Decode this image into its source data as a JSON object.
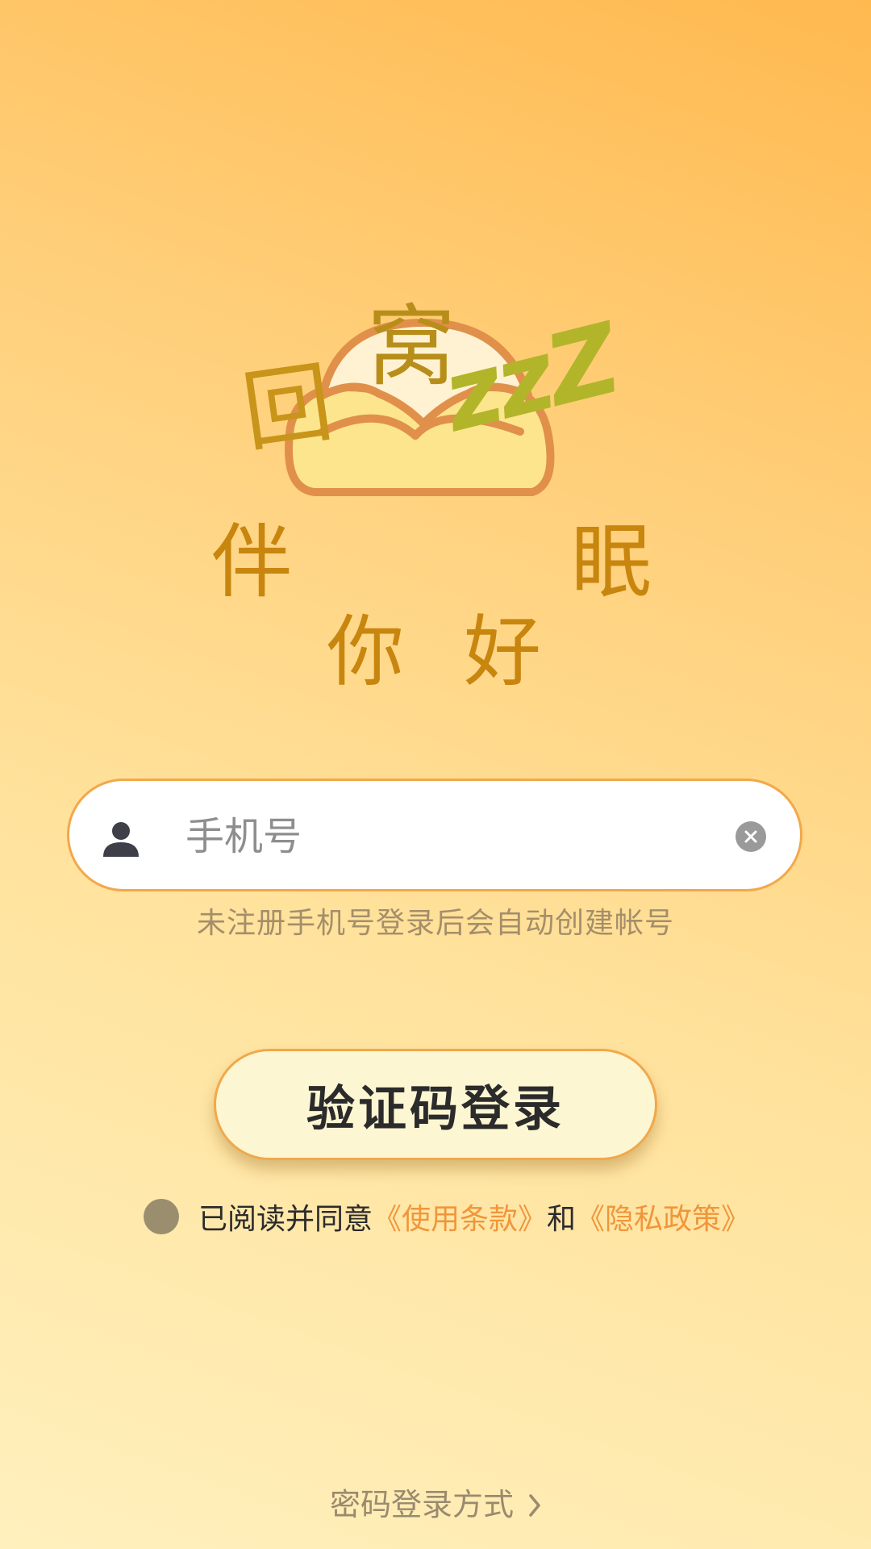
{
  "logo": {
    "chars": [
      "回",
      "窝",
      "伴",
      "眠",
      "你",
      "好"
    ],
    "zzz": "zzZ"
  },
  "phone": {
    "placeholder": "手机号",
    "value": "",
    "hint": "未注册手机号登录后会自动创建帐号"
  },
  "login": {
    "button_label": "验证码登录"
  },
  "agreement": {
    "prefix": "已阅读并同意",
    "terms": "《使用条款》",
    "and": "和",
    "privacy": "《隐私政策》"
  },
  "alt_login": {
    "label": "密码登录方式"
  },
  "colors": {
    "accent": "#f0963a",
    "border": "#f2a84a",
    "logo_text": "#c8860f",
    "zzz": "#b2b52a"
  },
  "icons": [
    "user-icon",
    "clear-icon",
    "chevron-right-icon"
  ]
}
